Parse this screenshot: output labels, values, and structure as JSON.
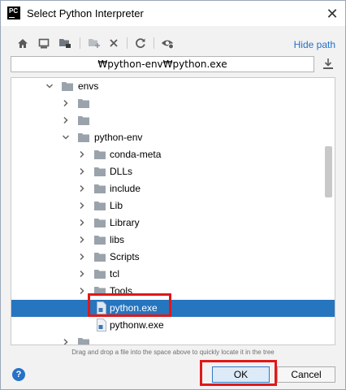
{
  "window": {
    "title": "Select Python Interpreter",
    "app_icon_text": "PC"
  },
  "toolbar": {
    "buttons": [
      "home-icon",
      "desktop-icon",
      "project-folder-icon",
      "new-folder-icon",
      "delete-icon",
      "refresh-icon",
      "show-hidden-icon"
    ],
    "hide_path_label": "Hide path"
  },
  "path": {
    "value": "₩python-env₩python.exe"
  },
  "tree": {
    "items": [
      {
        "label": "envs",
        "type": "folder",
        "expanded": true
      },
      {
        "label": "",
        "type": "folder",
        "expanded": false
      },
      {
        "label": "",
        "type": "folder",
        "expanded": false
      },
      {
        "label": "python-env",
        "type": "folder",
        "expanded": true
      },
      {
        "label": "conda-meta",
        "type": "folder",
        "expanded": false
      },
      {
        "label": "DLLs",
        "type": "folder",
        "expanded": false
      },
      {
        "label": "include",
        "type": "folder",
        "expanded": false
      },
      {
        "label": "Lib",
        "type": "folder",
        "expanded": false
      },
      {
        "label": "Library",
        "type": "folder",
        "expanded": false
      },
      {
        "label": "libs",
        "type": "folder",
        "expanded": false
      },
      {
        "label": "Scripts",
        "type": "folder",
        "expanded": false
      },
      {
        "label": "tcl",
        "type": "folder",
        "expanded": false
      },
      {
        "label": "Tools",
        "type": "folder",
        "expanded": false
      },
      {
        "label": "python.exe",
        "type": "file",
        "selected": true
      },
      {
        "label": "pythonw.exe",
        "type": "file"
      },
      {
        "label": "",
        "type": "folder",
        "expanded": false
      }
    ]
  },
  "hint": "Drag and drop a file into the space above to quickly locate it in the tree",
  "footer": {
    "help_label": "?",
    "ok_label": "OK",
    "cancel_label": "Cancel"
  },
  "colors": {
    "selection": "#2675bf",
    "link": "#2470c9",
    "highlight": "#e01818"
  }
}
